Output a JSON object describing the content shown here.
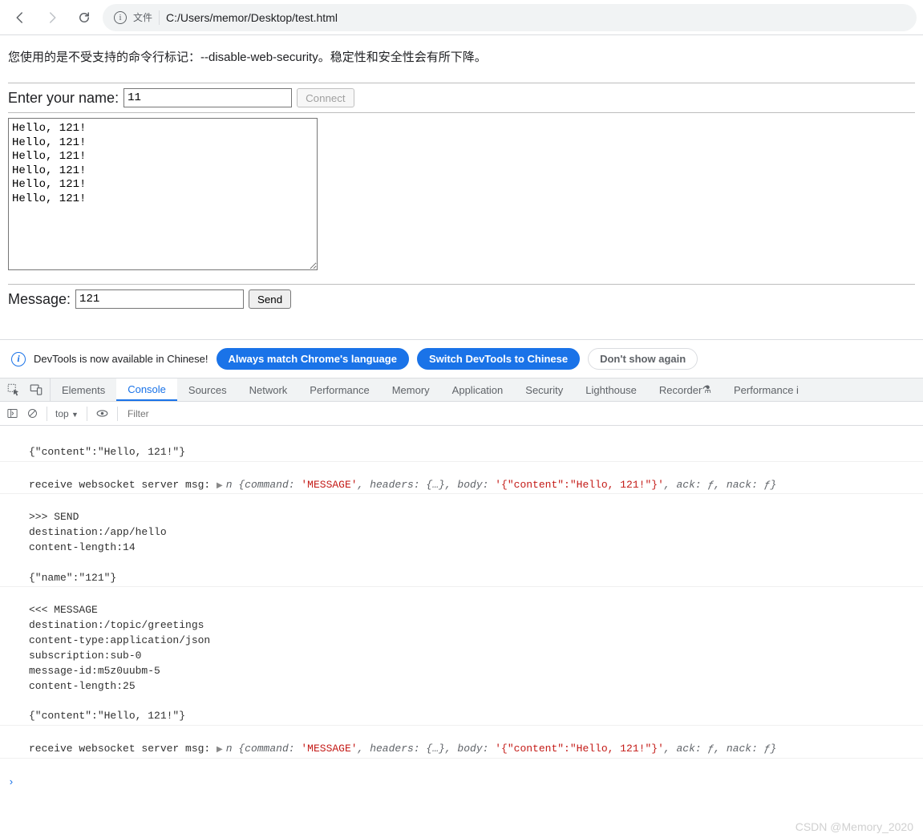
{
  "browser": {
    "file_label": "文件",
    "url": "C:/Users/memor/Desktop/test.html"
  },
  "security_warning": "您使用的是不受支持的命令行标记：--disable-web-security。稳定性和安全性会有所下降。",
  "form": {
    "name_label": "Enter your name:",
    "name_value": "11",
    "connect_label": "Connect",
    "output_text": "Hello, 121!\nHello, 121!\nHello, 121!\nHello, 121!\nHello, 121!\nHello, 121!",
    "message_label": "Message:",
    "message_value": "121",
    "send_label": "Send"
  },
  "devtools_banner": {
    "text": "DevTools is now available in Chinese!",
    "btn_always": "Always match Chrome's language",
    "btn_switch": "Switch DevTools to Chinese",
    "btn_dismiss": "Don't show again"
  },
  "devtools_tabs": {
    "items": [
      "Elements",
      "Console",
      "Sources",
      "Network",
      "Performance",
      "Memory",
      "Application",
      "Security",
      "Lighthouse",
      "Recorder",
      "Performance i"
    ],
    "active": "Console"
  },
  "console_toolbar": {
    "context": "top",
    "filter_placeholder": "Filter"
  },
  "console_log": {
    "line0": "{\"content\":\"Hello, 121!\"}",
    "recv_prefix": "receive websocket server msg: ",
    "recv_obj_open": "n {",
    "kv_command_k": "command: ",
    "kv_command_v": "'MESSAGE'",
    "kv_headers": ", headers: {…}",
    "kv_body_k": ", body: ",
    "kv_body_v": "'{\"content\":\"Hello, 121!\"}'",
    "kv_ack": ", ack: ƒ, nack: ƒ}",
    "send_block": ">>> SEND\ndestination:/app/hello\ncontent-length:14\n\n{\"name\":\"121\"}",
    "msg_block": "<<< MESSAGE\ndestination:/topic/greetings\ncontent-type:application/json\nsubscription:sub-0\nmessage-id:m5z0uubm-5\ncontent-length:25\n\n{\"content\":\"Hello, 121!\"}"
  },
  "watermark": "CSDN @Memory_2020"
}
